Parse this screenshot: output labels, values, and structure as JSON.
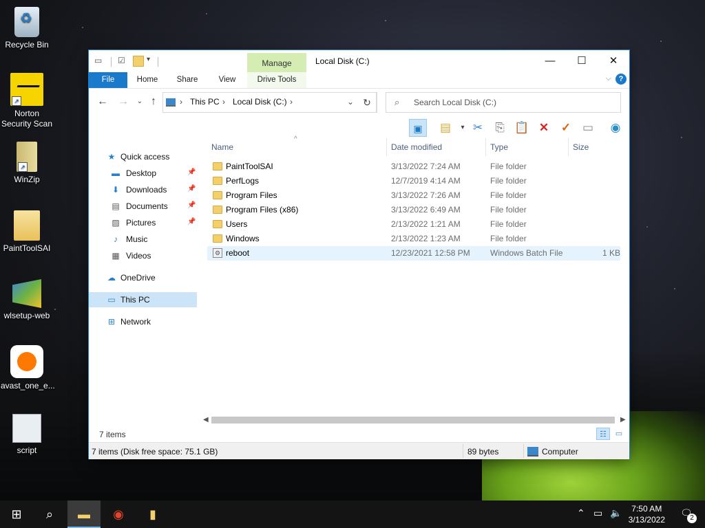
{
  "desktop": {
    "icons": [
      {
        "label": "Recycle Bin"
      },
      {
        "label": "Norton Security Scan"
      },
      {
        "label": "WinZip"
      },
      {
        "label": "PaintToolSAI"
      },
      {
        "label": "wlsetup-web"
      },
      {
        "label": "avast_one_e..."
      },
      {
        "label": "script"
      }
    ]
  },
  "window": {
    "title": "Local Disk (C:)",
    "context_tab": "Manage",
    "ribbon_tabs": [
      "File",
      "Home",
      "Share",
      "View",
      "Drive Tools"
    ],
    "breadcrumb": [
      "This PC",
      "Local Disk (C:)"
    ],
    "search_placeholder": "Search Local Disk (C:)",
    "nav": {
      "quick_access": "Quick access",
      "items": [
        {
          "label": "Desktop",
          "pinned": true
        },
        {
          "label": "Downloads",
          "pinned": true
        },
        {
          "label": "Documents",
          "pinned": true
        },
        {
          "label": "Pictures",
          "pinned": true
        },
        {
          "label": "Music",
          "pinned": false
        },
        {
          "label": "Videos",
          "pinned": false
        }
      ],
      "onedrive": "OneDrive",
      "this_pc": "This PC",
      "network": "Network"
    },
    "columns": [
      "Name",
      "Date modified",
      "Type",
      "Size"
    ],
    "files": [
      {
        "name": "PaintToolSAI",
        "date": "3/13/2022 7:24 AM",
        "type": "File folder",
        "size": "",
        "kind": "folder"
      },
      {
        "name": "PerfLogs",
        "date": "12/7/2019 4:14 AM",
        "type": "File folder",
        "size": "",
        "kind": "folder"
      },
      {
        "name": "Program Files",
        "date": "3/13/2022 7:26 AM",
        "type": "File folder",
        "size": "",
        "kind": "folder"
      },
      {
        "name": "Program Files (x86)",
        "date": "3/13/2022 6:49 AM",
        "type": "File folder",
        "size": "",
        "kind": "folder"
      },
      {
        "name": "Users",
        "date": "2/13/2022 1:21 AM",
        "type": "File folder",
        "size": "",
        "kind": "folder"
      },
      {
        "name": "Windows",
        "date": "2/13/2022 1:23 AM",
        "type": "File folder",
        "size": "",
        "kind": "folder"
      },
      {
        "name": "reboot",
        "date": "12/23/2021 12:58 PM",
        "type": "Windows Batch File",
        "size": "1 KB",
        "kind": "batch"
      }
    ],
    "item_count": "7 items",
    "status": {
      "summary": "7 items (Disk free space: 75.1 GB)",
      "size": "89 bytes",
      "location": "Computer"
    }
  },
  "taskbar": {
    "time": "7:50 AM",
    "date": "3/13/2022",
    "notifications": "2"
  },
  "colors": {
    "accent": "#1979ca",
    "manage_tab": "#d5ecb3",
    "selection": "#cce4f7",
    "hover_row": "#e5f3ff"
  }
}
